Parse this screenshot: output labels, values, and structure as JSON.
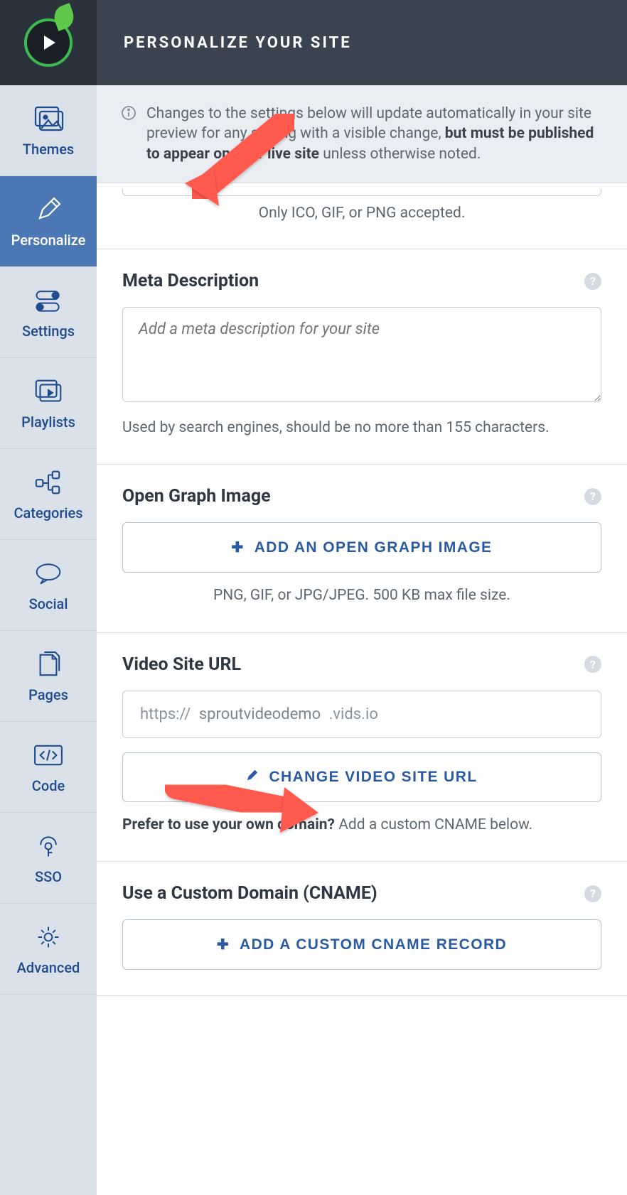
{
  "header": {
    "title": "PERSONALIZE YOUR SITE"
  },
  "notice": {
    "pre": "Changes to the settings below will update automatically in your site preview for any setting with a visible change, ",
    "bold": "but must be published to appear on your live site",
    "post": " unless otherwise noted."
  },
  "sidebar": {
    "items": [
      {
        "label": "Themes"
      },
      {
        "label": "Personalize"
      },
      {
        "label": "Settings"
      },
      {
        "label": "Playlists"
      },
      {
        "label": "Categories"
      },
      {
        "label": "Social"
      },
      {
        "label": "Pages"
      },
      {
        "label": "Code"
      },
      {
        "label": "SSO"
      },
      {
        "label": "Advanced"
      }
    ]
  },
  "favicon": {
    "helper": "Only ICO, GIF, or PNG accepted."
  },
  "meta": {
    "title": "Meta Description",
    "placeholder": "Add a meta description for your site",
    "helper": "Used by search engines, should be no more than 155 characters."
  },
  "og": {
    "title": "Open Graph Image",
    "button": "ADD AN OPEN GRAPH IMAGE",
    "helper": "PNG, GIF, or JPG/JPEG. 500 KB max file size."
  },
  "video_url": {
    "title": "Video Site URL",
    "prefix": "https://",
    "subdomain": "sproutvideodemo",
    "suffix": ".vids.io",
    "button": "CHANGE VIDEO SITE URL",
    "prefer_bold": "Prefer to use your own domain? ",
    "prefer_rest": "Add a custom CNAME below."
  },
  "cname": {
    "title": "Use a Custom Domain (CNAME)",
    "button": "ADD A CUSTOM CNAME RECORD"
  }
}
